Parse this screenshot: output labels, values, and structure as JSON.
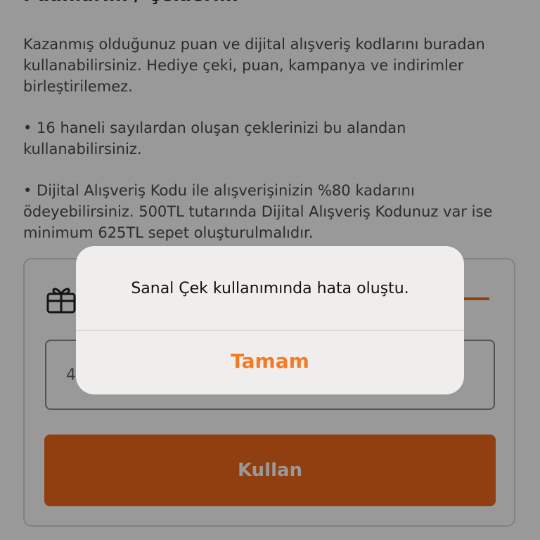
{
  "page": {
    "title": "Puanlarım / Çeklerim",
    "description": "Kazanmış olduğunuz puan ve dijital alışveriş kodlarını buradan kullanabilirsiniz. Hediye çeki, puan, kampanya ve indirimler birleştirilemez.",
    "bullet_1": "• 16 haneli sayılardan oluşan çeklerinizi bu alandan kullanabilirsiniz.",
    "bullet_2": "• Dijital Alışveriş Kodu ile alışverişinizin %80 kadarını ödeyebilirsiniz. 500TL tutarında Dijital Alışveriş Kodunuz var ise minimum 625TL sepet oluşturulmalıdır."
  },
  "card": {
    "gift_icon": "gift-icon",
    "code_input_value": "4",
    "use_button_label": "Kullan"
  },
  "alert": {
    "message": "Sanal Çek kullanımında hata oluştu.",
    "ok_label": "Tamam"
  },
  "colors": {
    "accent": "#f26a1b",
    "alert_button_text": "#f47a25",
    "alert_background": "#efeeec"
  }
}
